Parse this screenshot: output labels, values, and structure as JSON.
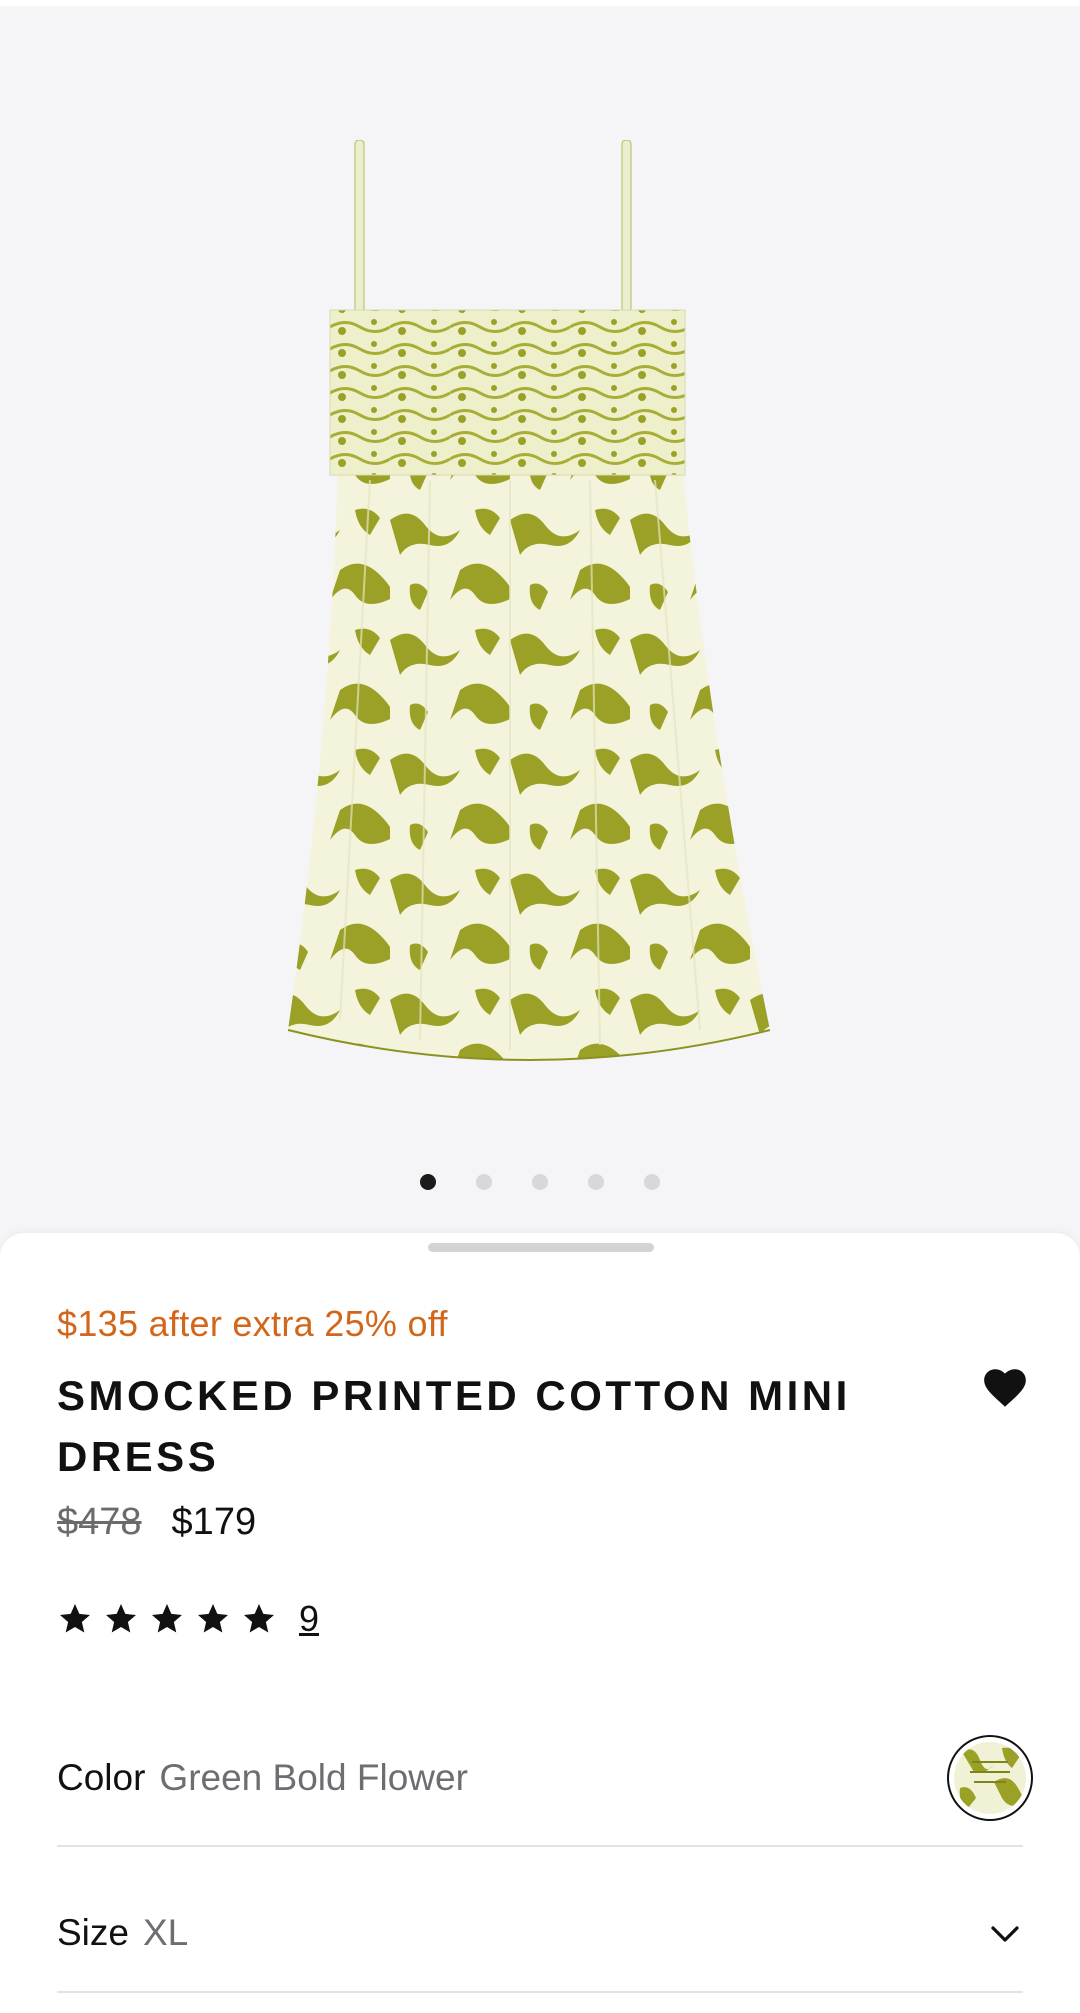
{
  "product": {
    "promo_text": "$135 after extra 25% off",
    "title": "SMOCKED PRINTED COTTON MINI DRESS",
    "price_original": "$478",
    "price_sale": "$179",
    "rating": {
      "stars": 5,
      "review_count": "9"
    },
    "color": {
      "label": "Color",
      "value": "Green Bold Flower"
    },
    "size": {
      "label": "Size",
      "value": "XL"
    }
  },
  "carousel": {
    "total_images": 5,
    "active_index": 0
  },
  "colors": {
    "promo": "#d2661a",
    "print_green": "#9aa126",
    "fabric_cream": "#f4f3dc"
  },
  "icons": {
    "wishlist": "heart-icon",
    "size_toggle": "chevron-down-icon",
    "rating": "star-icon"
  }
}
